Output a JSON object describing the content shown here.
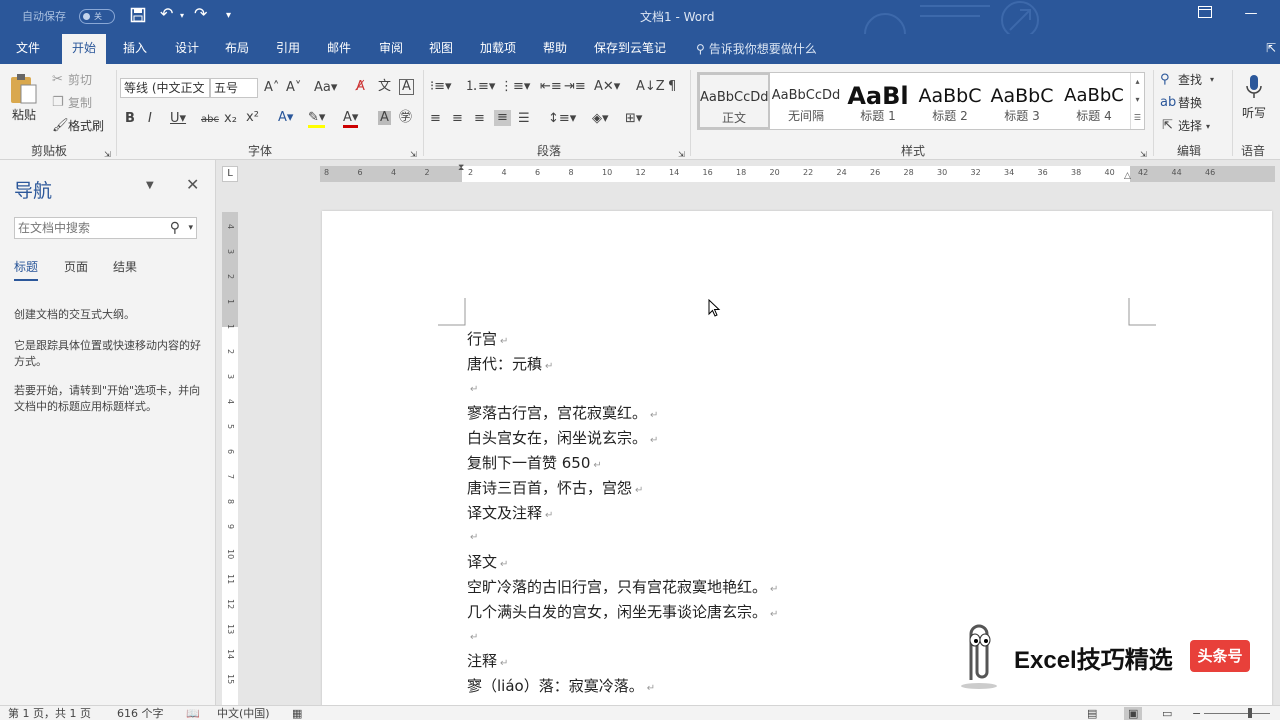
{
  "titlebar": {
    "autosave_label": "自动保存",
    "autosave_state": "关",
    "title": "文档1 - Word"
  },
  "tabs": [
    {
      "label": "文件"
    },
    {
      "label": "开始"
    },
    {
      "label": "插入"
    },
    {
      "label": "设计"
    },
    {
      "label": "布局"
    },
    {
      "label": "引用"
    },
    {
      "label": "邮件"
    },
    {
      "label": "审阅"
    },
    {
      "label": "视图"
    },
    {
      "label": "加载项"
    },
    {
      "label": "帮助"
    },
    {
      "label": "保存到云笔记"
    }
  ],
  "tell_me": "告诉我你想要做什么",
  "ribbon": {
    "clipboard": {
      "paste": "粘贴",
      "cut": "剪切",
      "copy": "复制",
      "format_painter": "格式刷",
      "group": "剪贴板"
    },
    "font": {
      "name": "等线 (中文正文",
      "size": "五号",
      "group": "字体"
    },
    "paragraph": {
      "group": "段落"
    },
    "styles": {
      "group": "样式",
      "items": [
        {
          "preview": "AaBbCcDd",
          "name": "正文"
        },
        {
          "preview": "AaBbCcDd",
          "name": "无间隔"
        },
        {
          "preview": "AaBl",
          "name": "标题 1"
        },
        {
          "preview": "AaBbC",
          "name": "标题 2"
        },
        {
          "preview": "AaBbC",
          "name": "标题 3"
        },
        {
          "preview": "AaBbC",
          "name": "标题 4"
        }
      ]
    },
    "editing": {
      "find": "查找",
      "replace": "替换",
      "select": "选择",
      "group": "编辑"
    },
    "voice": {
      "dictate": "听写",
      "group": "语音"
    }
  },
  "navpane": {
    "title": "导航",
    "search_placeholder": "在文档中搜索",
    "tabs": [
      "标题",
      "页面",
      "结果"
    ],
    "text1": "创建文档的交互式大纲。",
    "text2": "它是跟踪具体位置或快速移动内容的好方式。",
    "text3": "若要开始，请转到\"开始\"选项卡，并向文档中的标题应用标题样式。"
  },
  "ruler": {
    "labels": [
      "8",
      "6",
      "4",
      "2",
      "2",
      "4",
      "6",
      "8",
      "10",
      "12",
      "14",
      "16",
      "18",
      "20",
      "22",
      "24",
      "26",
      "28",
      "30",
      "32",
      "34",
      "36",
      "38",
      "40",
      "42",
      "44",
      "46"
    ],
    "vlabels": [
      "4",
      "3",
      "2",
      "1",
      "1",
      "2",
      "3",
      "4",
      "5",
      "6",
      "7",
      "8",
      "9",
      "10",
      "11",
      "12",
      "13",
      "14",
      "15"
    ]
  },
  "document": {
    "lines": [
      "行宫",
      "唐代：元稹",
      "",
      "寥落古行宫，宫花寂寞红。",
      "白头宫女在，闲坐说玄宗。",
      "复制下一首赞  650",
      "唐诗三百首，怀古，宫怨",
      "译文及注释",
      "",
      "译文",
      "空旷冷落的古旧行宫，只有宫花寂寞地艳红。",
      "几个满头白发的宫女，闲坐无事谈论唐玄宗。",
      "",
      "注释",
      "寥（liáo）落：寂寞冷落。"
    ],
    "paragraph_mark": "↵"
  },
  "statusbar": {
    "page": "第 1 页，共 1 页",
    "words": "616 个字",
    "language": "中文(中国)"
  },
  "watermark": {
    "text": "Excel技巧精选",
    "badge": "头条号"
  },
  "colors": {
    "accent": "#2b579a",
    "badge": "#e8403a"
  }
}
